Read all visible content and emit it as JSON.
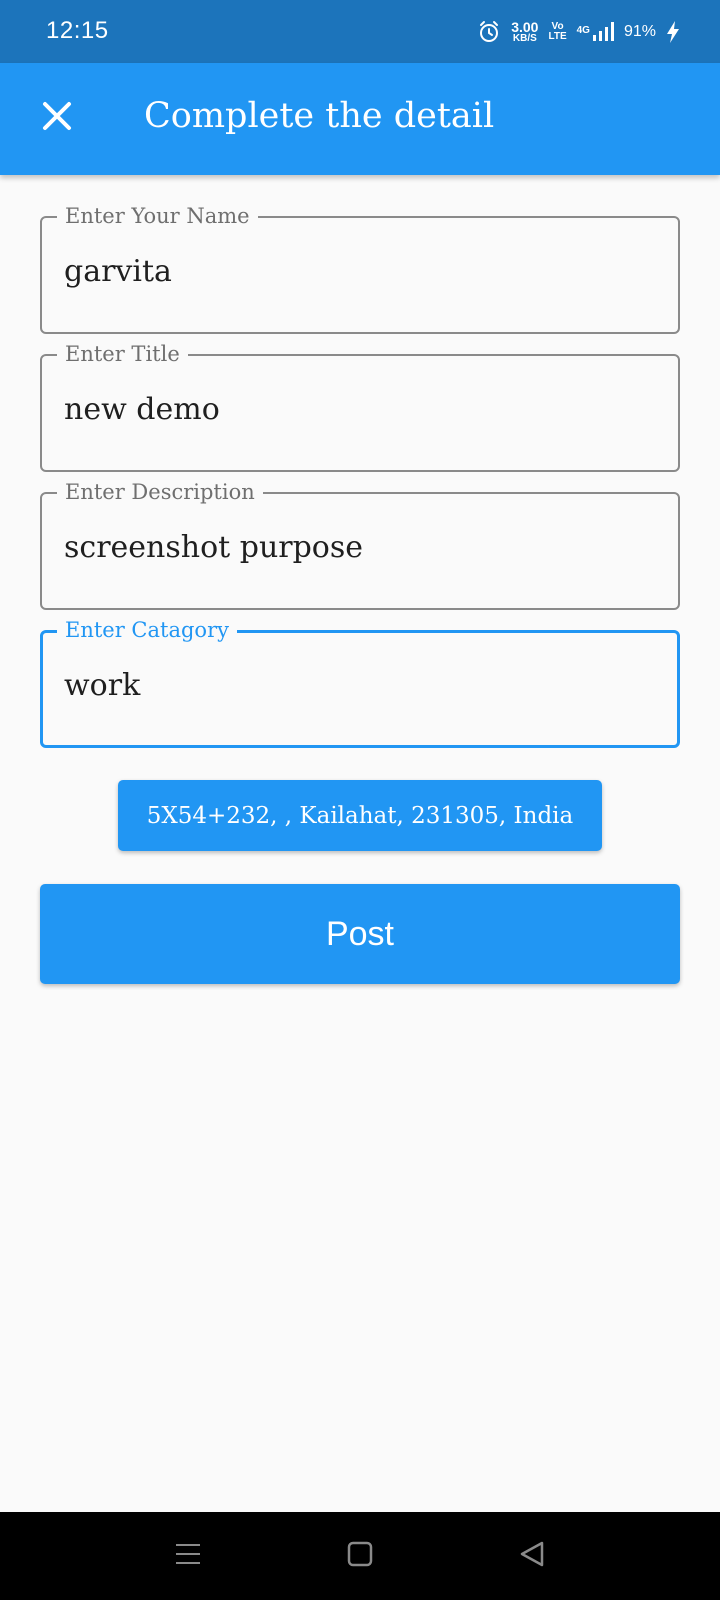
{
  "status_bar": {
    "time": "12:15",
    "speed_value": "3.00",
    "speed_unit": "KB/S",
    "volte_top": "Vo",
    "volte_bottom": "LTE",
    "network_type": "4G",
    "battery_percent": "91%",
    "icons": [
      "alarm-icon",
      "signal-icon",
      "charging-icon"
    ]
  },
  "app_bar": {
    "title": "Complete the detail",
    "close_icon": "close-icon",
    "background_color": "#2196f3"
  },
  "form": {
    "fields": [
      {
        "label": "Enter Your Name",
        "value": "garvita",
        "focused": false
      },
      {
        "label": "Enter Title",
        "value": "new demo",
        "focused": false
      },
      {
        "label": "Enter Description",
        "value": "screenshot purpose",
        "focused": false
      },
      {
        "label": "Enter Catagory",
        "value": "work",
        "focused": true
      }
    ],
    "focus_color": "#2196f3",
    "border_color": "#8a8a8a"
  },
  "location_button": {
    "label": "5X54+232, , Kailahat, 231305, India"
  },
  "post_button": {
    "label": "Post"
  },
  "nav_bar": {
    "icons": [
      "menu-icon",
      "home-icon",
      "back-icon"
    ]
  }
}
